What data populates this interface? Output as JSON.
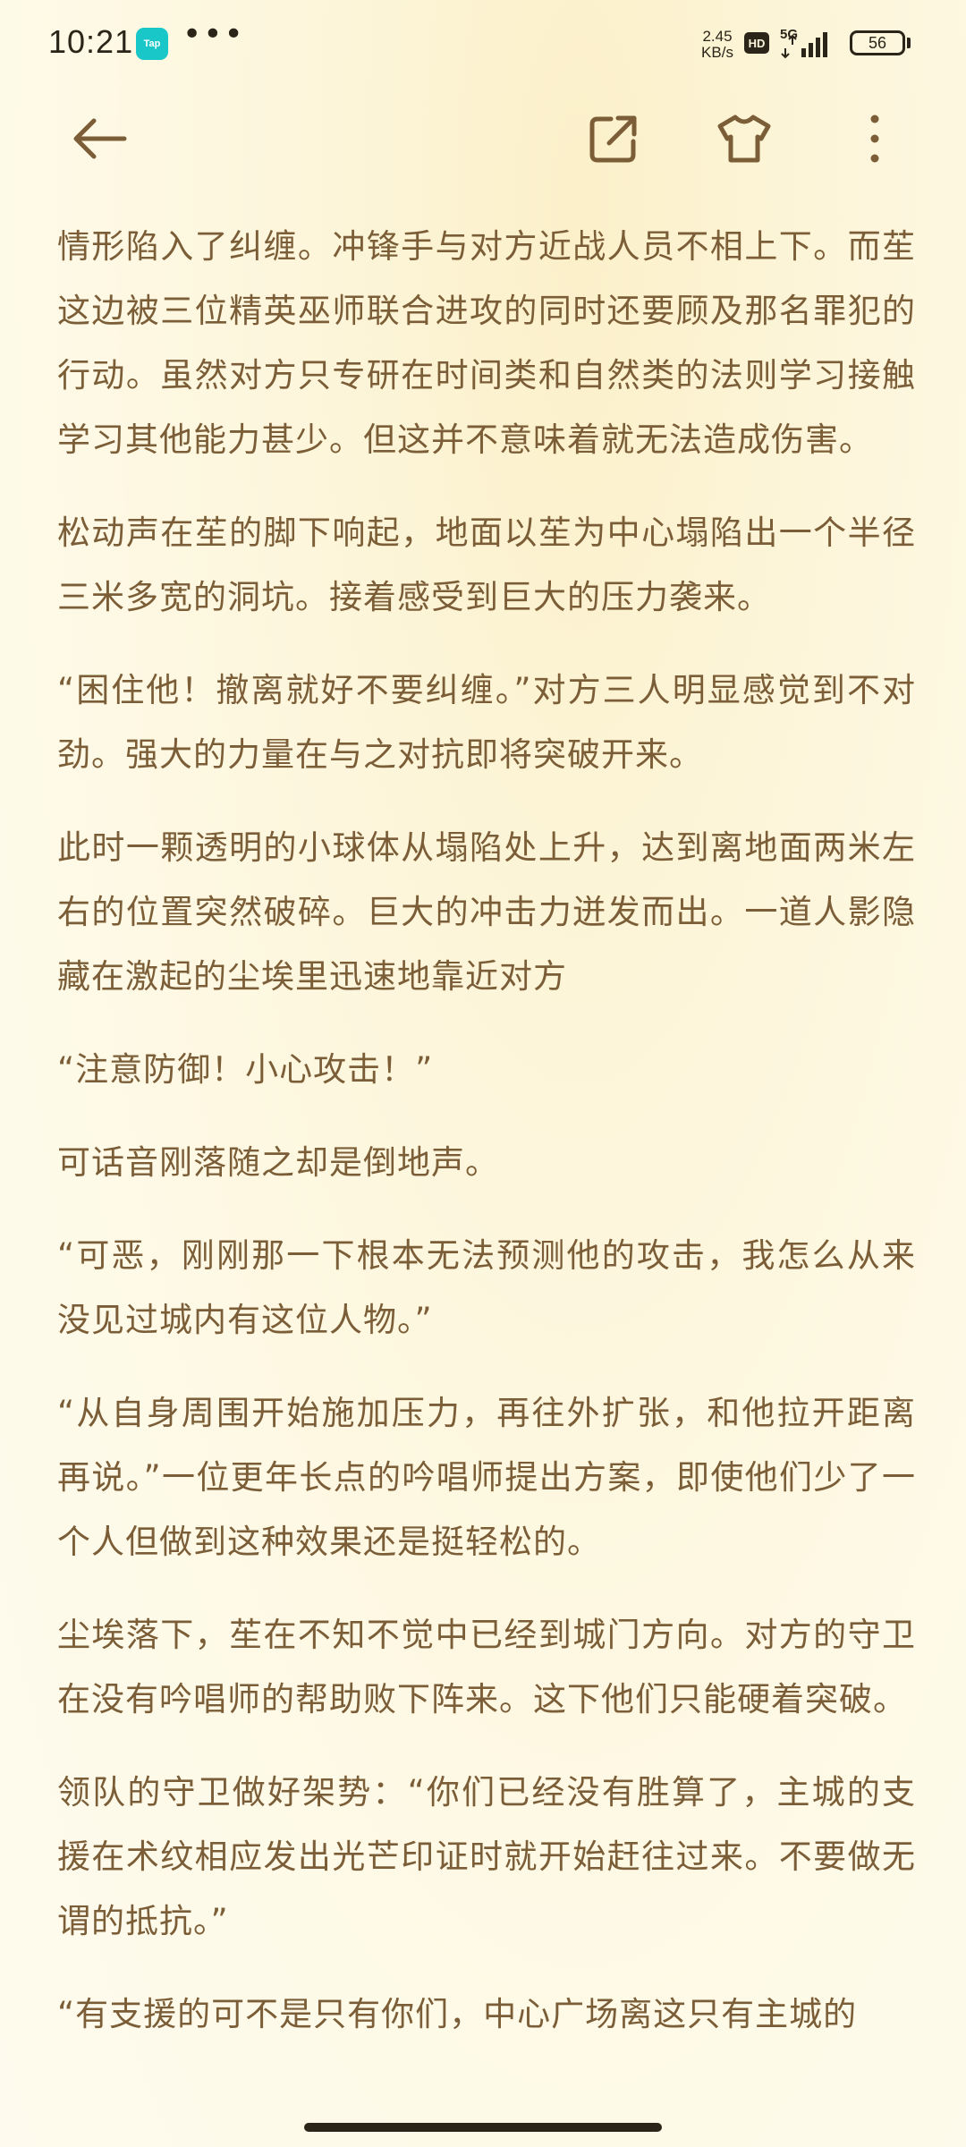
{
  "status_bar": {
    "time": "10:21",
    "app_icon_label": "Tap",
    "more": "•••",
    "net_speed_value": "2.45",
    "net_speed_unit": "KB/s",
    "hd": "HD",
    "network": "5G",
    "battery": "56"
  },
  "toolbar": {
    "back_icon": "arrow-left-icon",
    "share_icon": "share-icon",
    "theme_icon": "shirt-icon",
    "more_icon": "more-vertical-icon"
  },
  "reader": {
    "paragraphs": [
      "情形陷入了纠缠。冲锋手与对方近战人员不相上下。而苼这边被三位精英巫师联合进攻的同时还要顾及那名罪犯的行动。虽然对方只专研在时间类和自然类的法则学习接触学习其他能力甚少。但这并不意味着就无法造成伤害。",
      "松动声在苼的脚下响起，地面以苼为中心塌陷出一个半径三米多宽的洞坑。接着感受到巨大的压力袭来。",
      "“困住他！撤离就好不要纠缠。”对方三人明显感觉到不对劲。强大的力量在与之对抗即将突破开来。",
      "此时一颗透明的小球体从塌陷处上升，达到离地面两米左右的位置突然破碎。巨大的冲击力迸发而出。一道人影隐藏在激起的尘埃里迅速地靠近对方",
      "“注意防御！小心攻击！”",
      "可话音刚落随之却是倒地声。",
      "“可恶，刚刚那一下根本无法预测他的攻击，我怎么从来没见过城内有这位人物。”",
      "“从自身周围开始施加压力，再往外扩张，和他拉开距离再说。”一位更年长点的吟唱师提出方案，即使他们少了一个人但做到这种效果还是挺轻松的。",
      "尘埃落下，苼在不知不觉中已经到城门方向。对方的守卫在没有吟唱师的帮助败下阵来。这下他们只能硬着突破。",
      "领队的守卫做好架势：“你们已经没有胜算了，主城的支援在术纹相应发出光芒印证时就开始赶往过来。不要做无谓的抵抗。”",
      "“有支援的可不是只有你们，中心广场离这只有主城的"
    ]
  },
  "colors": {
    "text": "#7b5e37",
    "icon": "#7b5e37",
    "status": "#2b2418",
    "background": "#fdf6dc"
  }
}
